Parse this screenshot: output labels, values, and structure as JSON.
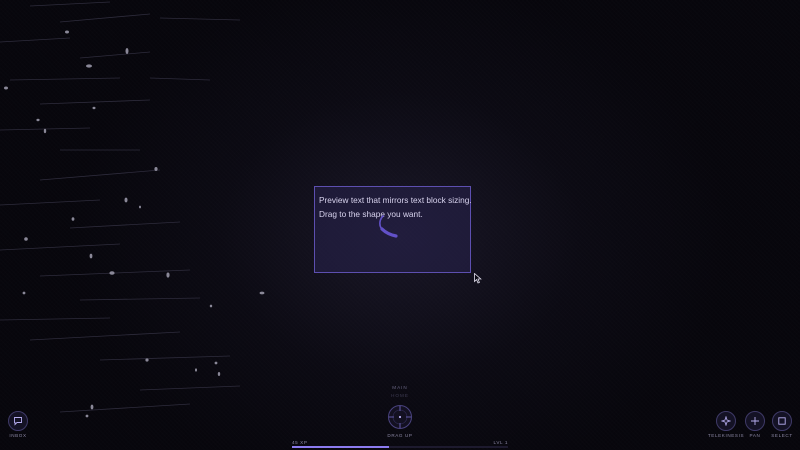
{
  "preview": {
    "line1": "Preview text that mirrors text block sizing.",
    "line2": "Drag to the shape you want."
  },
  "dock": {
    "left": [
      {
        "label": "INBOX",
        "icon": "chat-bubble-icon"
      }
    ],
    "right": [
      {
        "label": "TELEKINESIS",
        "icon": "sparkle-icon"
      },
      {
        "label": "PAN",
        "icon": "move-cross-icon"
      },
      {
        "label": "SELECT",
        "icon": "square-select-icon"
      }
    ]
  },
  "mode": {
    "top_label": "MAIN",
    "sub_label": "HOME",
    "bottom_label": "DRAG UP"
  },
  "progress": {
    "xp_label": "45 XP",
    "level_label": "LVL 1",
    "fill_fraction": 0.45
  },
  "colors": {
    "accent": "#8c7bf0",
    "block_border": "#5d4fb0",
    "background": "#07060c"
  }
}
